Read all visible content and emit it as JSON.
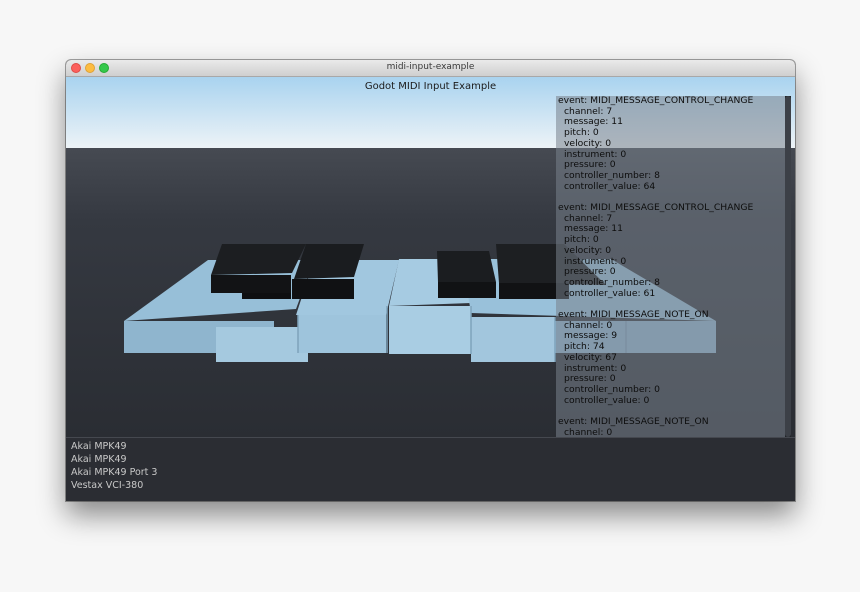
{
  "window": {
    "title": "midi-input-example"
  },
  "app": {
    "title": "Godot MIDI Input Example"
  },
  "log": [
    {
      "event": "event: MIDI_MESSAGE_CONTROL_CHANGE",
      "fields": [
        "channel: 7",
        "message: 11",
        "pitch: 0",
        "velocity: 0",
        "instrument: 0",
        "pressure: 0",
        "controller_number: 8",
        "controller_value: 64"
      ]
    },
    {
      "event": "event: MIDI_MESSAGE_CONTROL_CHANGE",
      "fields": [
        "channel: 7",
        "message: 11",
        "pitch: 0",
        "velocity: 0",
        "instrument: 0",
        "pressure: 0",
        "controller_number: 8",
        "controller_value: 61"
      ]
    },
    {
      "event": "event: MIDI_MESSAGE_NOTE_ON",
      "fields": [
        "channel: 0",
        "message: 9",
        "pitch: 74",
        "velocity: 67",
        "instrument: 0",
        "pressure: 0",
        "controller_number: 0",
        "controller_value: 0"
      ]
    },
    {
      "event": "event: MIDI_MESSAGE_NOTE_ON",
      "fields": [
        "channel: 0"
      ]
    }
  ],
  "devices": [
    "Akai MPK49",
    "Akai MPK49",
    "Akai MPK49 Port 3",
    "Vestax VCI-380"
  ],
  "colors": {
    "sky_top": "#a9d3ef",
    "sky_bottom": "#edf3f7",
    "ground": "#30343c",
    "white_key": "#9cc3dc",
    "black_key": "#141618",
    "log_panel": "#7a8591"
  }
}
